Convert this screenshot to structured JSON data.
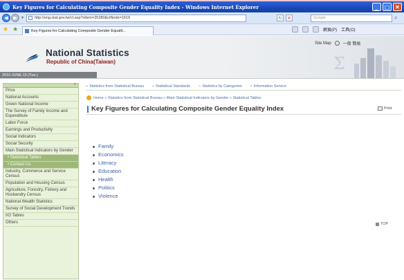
{
  "window": {
    "title": "Key Figures for Calculating Composite Gender Equality Index - Windows Internet Explorer",
    "controls": [
      "_",
      "□",
      "✕"
    ]
  },
  "address_bar": {
    "url": "http://eng.stat.gov.tw/ct.asp?xItem=25280&ctNode=1619",
    "search_placeholder": "Google"
  },
  "tab": {
    "label": "Key Figures for Calculating Composite Gender Equalit..."
  },
  "command_bar": {
    "page": "網頁(P)",
    "tools": "工具(O)"
  },
  "banner": {
    "title": "National Statistics",
    "subtitle": "Republic of China(Taiwan)",
    "date": "2010.JUNE.15 (Tue.)",
    "site_map": "Site Map",
    "chinese": "中文",
    "chinese_site": "一般 簡易"
  },
  "sidebar": {
    "items": [
      {
        "label": "Price",
        "sub": false
      },
      {
        "label": "National Accounts",
        "sub": false
      },
      {
        "label": "Green National Income",
        "sub": false
      },
      {
        "label": "The Survey of Family Income and Expenditure",
        "sub": false
      },
      {
        "label": "Labor Force",
        "sub": false
      },
      {
        "label": "Earnings and Productivity",
        "sub": false
      },
      {
        "label": "Social Indicators",
        "sub": false
      },
      {
        "label": "Social Security",
        "sub": false
      },
      {
        "label": "Main Statistical Indicators by Gender",
        "sub": false
      },
      {
        "label": "• Statistical Tables",
        "sub": true
      },
      {
        "label": "• Contact Us",
        "sub": true
      },
      {
        "label": "Industry, Commerce and Service Census",
        "sub": false
      },
      {
        "label": "Population and Housing Census",
        "sub": false
      },
      {
        "label": "Agriculture, Forestry, Fishery and Husbandry Census",
        "sub": false
      },
      {
        "label": "National Wealth Statistics",
        "sub": false
      },
      {
        "label": "Survey of Social Development Trends",
        "sub": false
      },
      {
        "label": "I/O Tables",
        "sub": false
      },
      {
        "label": "Others",
        "sub": false
      }
    ]
  },
  "top_nav": [
    "Statistics from Statistical Bureau",
    "Statistical Standards",
    "Statistics by Categories",
    "Information Service"
  ],
  "breadcrumb": "Home » Statistics from Statistical Bureau » Main Statistical Indicators by Gender » Statistical Tables",
  "page_title": "Key Figures for Calculating Composite Gender Equality Index",
  "print_label": "Print",
  "topics": [
    "Family",
    "Economics",
    "Literacy",
    "Education",
    "Health",
    "Politics",
    "Violence"
  ],
  "top_label": "TOP",
  "colors": {
    "titlebar": "#1a48b8",
    "sidebar_bg": "#e9f2da",
    "link": "#3b5fa5",
    "subtitle": "#8d1a1a"
  }
}
